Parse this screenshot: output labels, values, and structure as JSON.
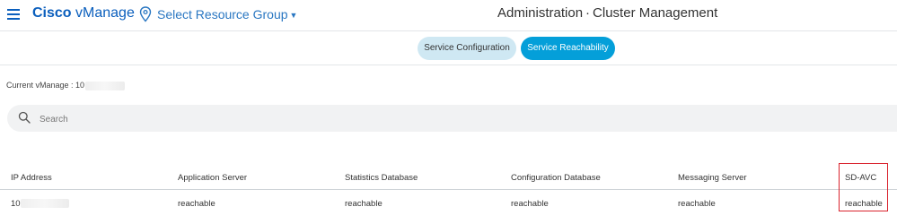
{
  "header": {
    "brand_bold": "Cisco",
    "brand_rest": " vManage",
    "resource_group_label": "Select Resource Group",
    "title_section": "Administration",
    "title_separator": "·",
    "title_page": "Cluster Management"
  },
  "tabs": [
    {
      "label": "Service Configuration",
      "active": false
    },
    {
      "label": "Service Reachability",
      "active": true
    }
  ],
  "current_vmanage": {
    "label": "Current vManage : 10"
  },
  "search": {
    "placeholder": "Search",
    "value": ""
  },
  "table": {
    "columns": [
      "IP Address",
      "Application Server",
      "Statistics Database",
      "Configuration Database",
      "Messaging Server",
      "SD-AVC"
    ],
    "rows": [
      [
        "10",
        "reachable",
        "reachable",
        "reachable",
        "reachable",
        "reachable"
      ]
    ]
  },
  "colors": {
    "brand": "#0b5fbd",
    "active_tab": "#049fd9",
    "inactive_tab": "#cfe8f3",
    "highlight": "#d9232e"
  },
  "icons": [
    "menu-icon",
    "location-pin-icon",
    "caret-down-icon",
    "search-icon"
  ]
}
